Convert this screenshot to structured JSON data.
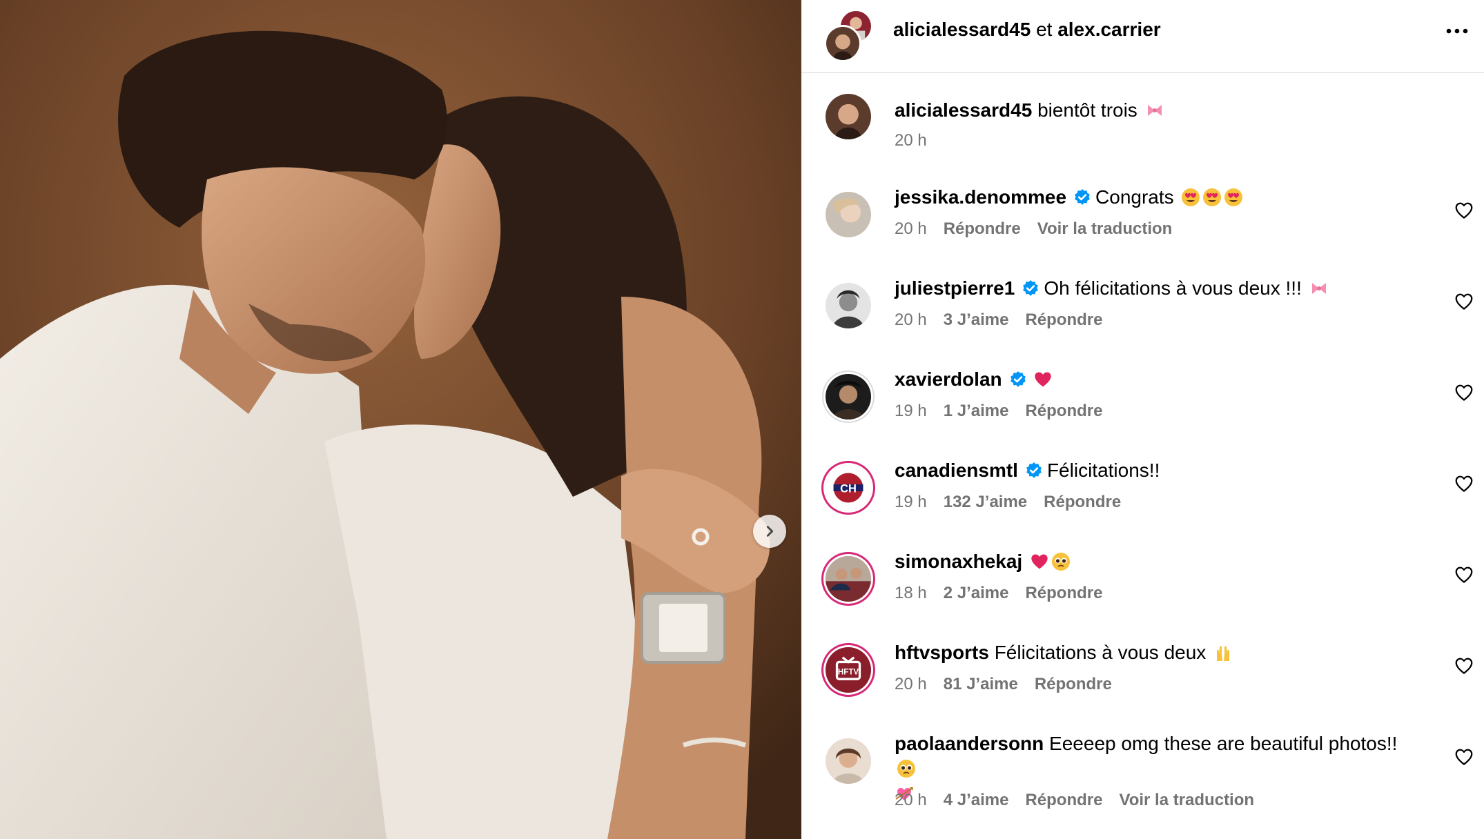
{
  "header": {
    "user1": "alicialessard45",
    "conjunction": "et",
    "user2": "alex.carrier",
    "more_icon": "more-horizontal-icon"
  },
  "caption": {
    "username": "alicialessard45",
    "text": "bientôt trois",
    "emoji": "ribbon",
    "time": "20 h"
  },
  "comments": [
    {
      "username": "jessika.denommee",
      "verified": true,
      "text": "Congrats",
      "emoji": [
        "heart-eyes",
        "heart-eyes",
        "heart-eyes"
      ],
      "time": "20 h",
      "likes": "",
      "reply": "Répondre",
      "translate": "Voir la traduction"
    },
    {
      "username": "juliestpierre1",
      "verified": true,
      "text": "Oh félicitations à vous deux !!!",
      "emoji": [
        "ribbon"
      ],
      "time": "20 h",
      "likes": "3 J’aime",
      "reply": "Répondre",
      "translate": ""
    },
    {
      "username": "xavierdolan",
      "verified": true,
      "text": "",
      "emoji": [
        "red-heart"
      ],
      "time": "19 h",
      "likes": "1 J’aime",
      "reply": "Répondre",
      "translate": ""
    },
    {
      "username": "canadiensmtl",
      "verified": true,
      "text": "Félicitations!!",
      "emoji": [],
      "time": "19 h",
      "likes": "132 J’aime",
      "reply": "Répondre",
      "translate": ""
    },
    {
      "username": "simonaxhekaj",
      "verified": false,
      "text": "",
      "emoji": [
        "red-heart",
        "pleading-face"
      ],
      "time": "18 h",
      "likes": "2 J’aime",
      "reply": "Répondre",
      "translate": ""
    },
    {
      "username": "hftvsports",
      "verified": false,
      "text": "Félicitations à vous deux",
      "emoji": [
        "raising-hands"
      ],
      "time": "20 h",
      "likes": "81 J’aime",
      "reply": "Répondre",
      "translate": ""
    },
    {
      "username": "paolaandersonn",
      "verified": false,
      "text": "Eeeeep omg these are beautiful photos!!",
      "emoji": [
        "pleading-face",
        "heart-with-arrow"
      ],
      "time": "20 h",
      "likes": "4 J’aime",
      "reply": "Répondre",
      "translate": "Voir la traduction"
    }
  ],
  "colors": {
    "verified": "#0095f6",
    "meta_text": "#737373",
    "divider": "#dbdbdb",
    "story_ring": "#d62976"
  }
}
